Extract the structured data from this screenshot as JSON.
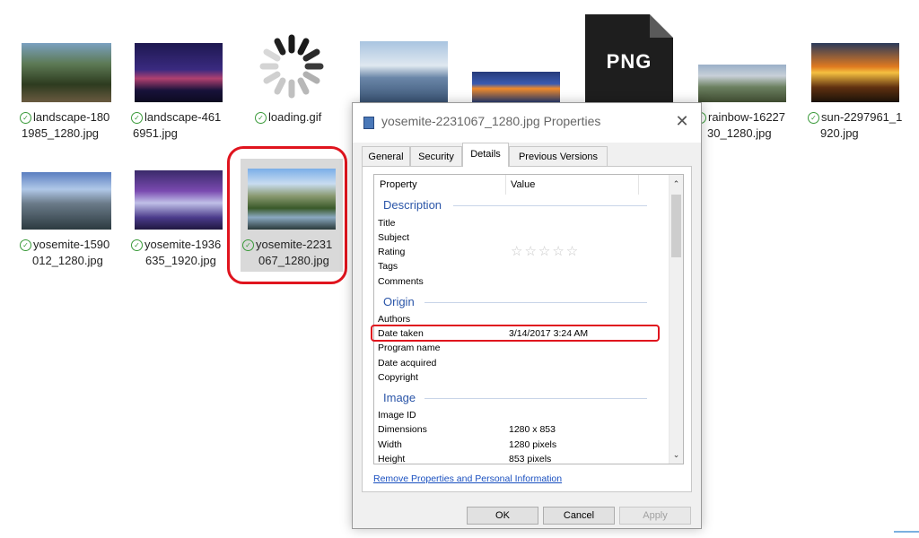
{
  "files": [
    {
      "name_l1": "landscape-180",
      "name_l2": "1985_1280.jpg"
    },
    {
      "name_l1": "landscape-461",
      "name_l2": "6951.jpg"
    },
    {
      "name_l1": "loading.gif",
      "name_l2": ""
    },
    {
      "name_l1": "rainbow-16227",
      "name_l2": "30_1280.jpg"
    },
    {
      "name_l1": "sun-2297961_1",
      "name_l2": "920.jpg"
    },
    {
      "name_l1": "yosemite-1590",
      "name_l2": "012_1280.jpg"
    },
    {
      "name_l1": "yosemite-1936",
      "name_l2": "635_1920.jpg"
    },
    {
      "name_l1": "yosemite-2231",
      "name_l2": "067_1280.jpg"
    }
  ],
  "png_icon_label": "PNG",
  "dialog": {
    "title": "yosemite-2231067_1280.jpg Properties",
    "close": "✕",
    "tabs": [
      "General",
      "Security",
      "Details",
      "Previous Versions"
    ],
    "active_tab": "Details",
    "columns": {
      "property": "Property",
      "value": "Value"
    },
    "sections": {
      "description": "Description",
      "origin": "Origin",
      "image": "Image"
    },
    "description_rows": [
      "Title",
      "Subject",
      "Rating",
      "Tags",
      "Comments"
    ],
    "rating_stars": "☆☆☆☆☆",
    "origin_rows": {
      "authors": "Authors",
      "date_taken": "Date taken",
      "date_taken_value": "3/14/2017 3:24 AM",
      "program_name": "Program name",
      "date_acquired": "Date acquired",
      "copyright": "Copyright"
    },
    "image_rows": {
      "image_id": "Image ID",
      "dimensions": "Dimensions",
      "dimensions_value": "1280 x 853",
      "width": "Width",
      "width_value": "1280 pixels",
      "height": "Height",
      "height_value": "853 pixels"
    },
    "remove_link": "Remove Properties and Personal Information",
    "buttons": {
      "ok": "OK",
      "cancel": "Cancel",
      "apply": "Apply"
    }
  }
}
